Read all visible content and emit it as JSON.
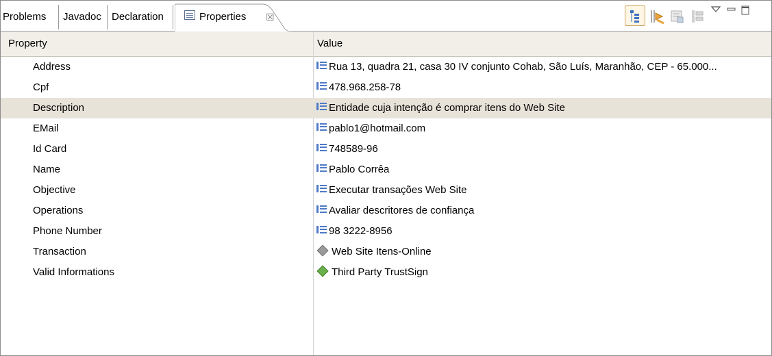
{
  "tabs": {
    "problems": "Problems",
    "javadoc": "Javadoc",
    "declaration": "Declaration",
    "properties": "Properties",
    "close": "☒"
  },
  "toolbar": {
    "icons": [
      "show-categories-icon",
      "show-advanced-icon",
      "filter-icon",
      "restore-default-icon",
      "view-menu-icon",
      "minimize-icon",
      "maximize-icon"
    ]
  },
  "table": {
    "headers": {
      "property": "Property",
      "value": "Value"
    },
    "rows": [
      {
        "property": "Address",
        "value": "Rua 13, quadra 21, casa 30 IV conjunto Cohab, São Luís, Maranhão, CEP - 65.000...",
        "icon": "list"
      },
      {
        "property": "Cpf",
        "value": "478.968.258-78",
        "icon": "list"
      },
      {
        "property": "Description",
        "value": "Entidade cuja intenção é comprar itens do Web Site",
        "icon": "list"
      },
      {
        "property": "EMail",
        "value": "pablo1@hotmail.com",
        "icon": "list"
      },
      {
        "property": "Id Card",
        "value": "748589-96",
        "icon": "list"
      },
      {
        "property": "Name",
        "value": "Pablo Corrêa",
        "icon": "list"
      },
      {
        "property": "Objective",
        "value": "Executar transações Web Site",
        "icon": "list"
      },
      {
        "property": "Operations",
        "value": "Avaliar descritores de confiança",
        "icon": "list"
      },
      {
        "property": "Phone Number",
        "value": "98 3222-8956",
        "icon": "list"
      },
      {
        "property": "Transaction",
        "value": "Web Site Itens-Online",
        "icon": "grey-diamond"
      },
      {
        "property": "Valid Informations",
        "value": "Third Party TrustSign",
        "icon": "green-diamond"
      }
    ],
    "selected_row": "Description"
  }
}
